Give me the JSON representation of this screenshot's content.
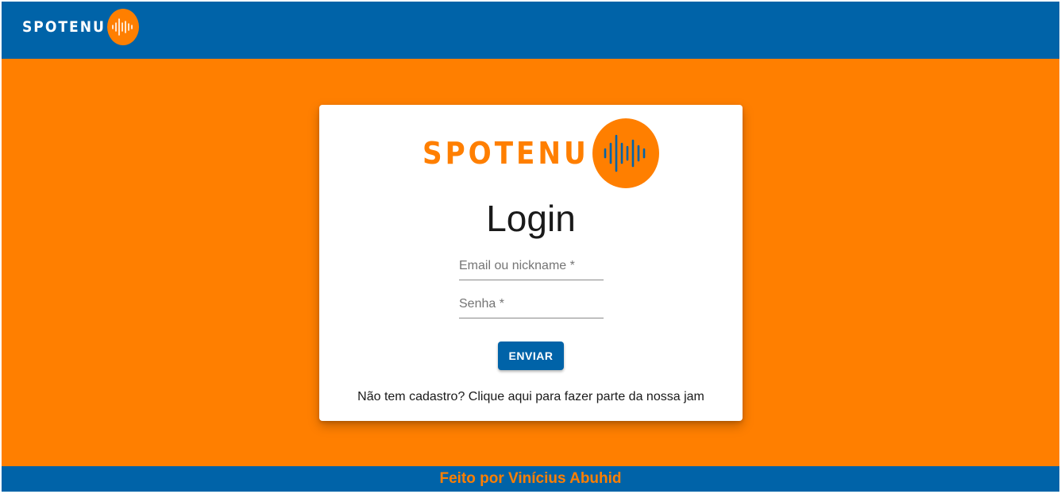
{
  "header": {
    "logo_text": "SPOTENU"
  },
  "login_card": {
    "logo_text": "SPOTENU",
    "title": "Login",
    "email_placeholder": "Email ou nickname *",
    "password_placeholder": "Senha *",
    "submit_label": "ENVIAR",
    "signup_text": "Não tem cadastro? Clique aqui para fazer parte da nossa jam"
  },
  "footer": {
    "text": "Feito por Vinícius Abuhid"
  },
  "colors": {
    "primary_blue": "#0063a8",
    "accent_orange": "#ff7f00"
  },
  "icons": {
    "logo_mark": "soundwave-icon"
  }
}
